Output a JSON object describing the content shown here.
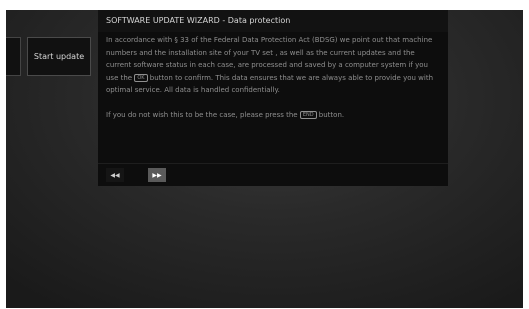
{
  "menu": {
    "start_update_label": "Start update"
  },
  "dialog": {
    "title": "SOFTWARE UPDATE WIZARD - Data protection",
    "paragraph1_part1": "In accordance with § 33 of the Federal Data Protection Act (BDSG) we point out that machine numbers and the installation site of your TV set , as well as the current updates and the current software status in each case, are processed and saved by a computer system if you use the ",
    "paragraph1_key": "OK",
    "paragraph1_part2": " button to confirm. This data ensures that we are always able to provide you with optimal service. All data is handled confidentially.",
    "paragraph2_part1": "If you do not wish this to be the case, please press the ",
    "paragraph2_key": "END",
    "paragraph2_part2": " button."
  },
  "controls": {
    "back_icon": "◀◀",
    "next_icon": "▶▶"
  }
}
